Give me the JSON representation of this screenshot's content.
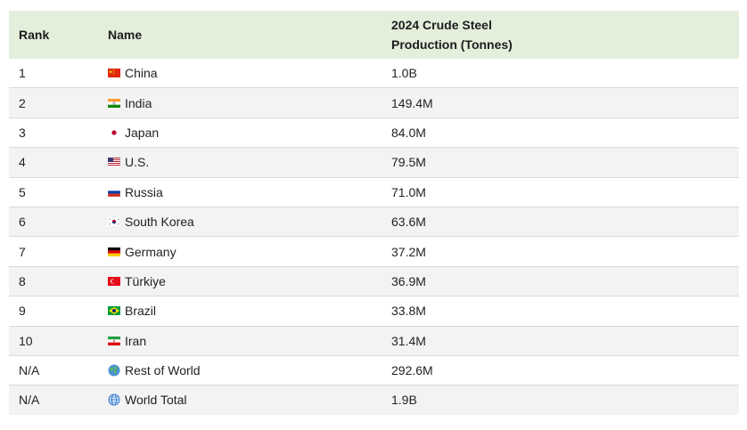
{
  "chart_data": {
    "type": "table",
    "columns": [
      "Rank",
      "Name",
      "2024 Crude Steel Production (Tonnes)"
    ],
    "header_lines": [
      "2024 Crude Steel",
      "Production (Tonnes)"
    ],
    "rows": [
      {
        "rank": "1",
        "name": "China",
        "value": "1.0B",
        "icon": "china-flag-icon"
      },
      {
        "rank": "2",
        "name": "India",
        "value": "149.4M",
        "icon": "india-flag-icon"
      },
      {
        "rank": "3",
        "name": "Japan",
        "value": "84.0M",
        "icon": "japan-flag-icon"
      },
      {
        "rank": "4",
        "name": "U.S.",
        "value": "79.5M",
        "icon": "us-flag-icon"
      },
      {
        "rank": "5",
        "name": "Russia",
        "value": "71.0M",
        "icon": "russia-flag-icon"
      },
      {
        "rank": "6",
        "name": "South Korea",
        "value": "63.6M",
        "icon": "south-korea-flag-icon"
      },
      {
        "rank": "7",
        "name": "Germany",
        "value": "37.2M",
        "icon": "germany-flag-icon"
      },
      {
        "rank": "8",
        "name": "Türkiye",
        "value": "36.9M",
        "icon": "turkiye-flag-icon"
      },
      {
        "rank": "9",
        "name": "Brazil",
        "value": "33.8M",
        "icon": "brazil-flag-icon"
      },
      {
        "rank": "10",
        "name": "Iran",
        "value": "31.4M",
        "icon": "iran-flag-icon"
      },
      {
        "rank": "N/A",
        "name": "Rest of World",
        "value": "292.6M",
        "icon": "earth-globe-icon"
      },
      {
        "rank": "N/A",
        "name": "World Total",
        "value": "1.9B",
        "icon": "globe-meridians-icon"
      }
    ]
  },
  "colors": {
    "header_bg": "#e3eedb",
    "row_alt_bg": "#f3f3f3",
    "row_border": "#d9d9d9"
  }
}
